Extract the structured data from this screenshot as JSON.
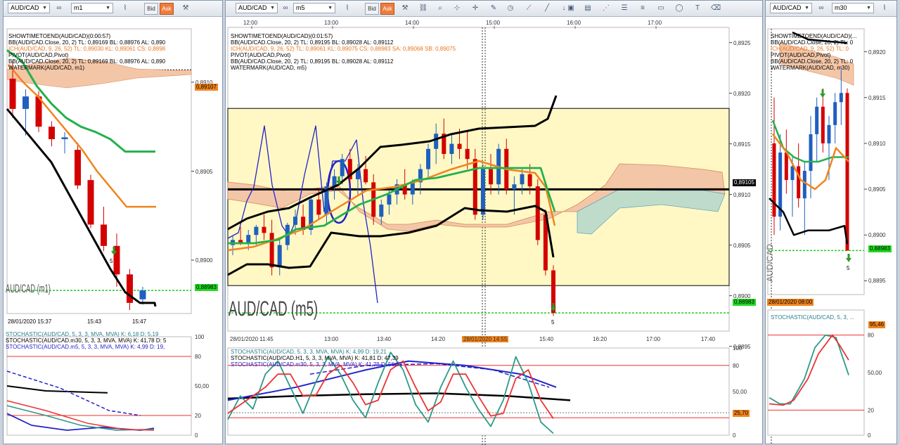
{
  "windows": [
    {
      "symbol": "AUD/CAD",
      "timeframe": "m1",
      "price_tick_labels": [
        "0,8910",
        "0,8905",
        "0,8900"
      ],
      "current_price": "0,88983",
      "pivot_price": "0,89107",
      "time_labels": [
        "28/01/2020 15:37",
        "15:43",
        "15:47"
      ],
      "watermark": "AUD/CAD (m1)",
      "indicator_lines": [
        {
          "text": "SHOWTIMETOEND(AUD/CAD)(0:00:57)",
          "color": "#000000"
        },
        {
          "text": "BB(AUD/CAD.Close, 20, 2)  TL: 0,89169  BL: 0,88976  AL: 0,890",
          "color": "#000000"
        },
        {
          "text": "ICH(AUD/CAD, 9, 26, 52)  TL: 0,89030  KL: 0,89061  CS: 0,8898",
          "color": "#e8761e"
        },
        {
          "text": "PIVOT(AUD/CAD,Pivot)",
          "color": "#000000"
        },
        {
          "text": "BB(AUD/CAD.Close, 20, 2)  TL: 0,89169  BL: 0,88976  AL: 0,890",
          "color": "#000000"
        },
        {
          "text": "WATERMARK(AUD/CAD, m1)",
          "color": "#000000"
        }
      ],
      "stoch_lines": [
        {
          "text": "STOCHASTIC(AUD/CAD, 5, 3, 3, MVA, MVA)  K: 6,18  D: 5,19",
          "color": "#2b7d8a"
        },
        {
          "text": "STOCHASTIC(AUD/CAD.m30, 5, 3, 3, MVA, MVA)  K: 41,78  D: 5",
          "color": "#000000"
        },
        {
          "text": "STOCHASTIC(AUD/CAD.m5, 5, 3, 3, MVA, MVA)  K: 4,99  D: 19,",
          "color": "#2222cc"
        }
      ],
      "stoch_ticks": [
        "100",
        "80",
        "50,00",
        "20",
        "0"
      ],
      "signal_label": "5"
    },
    {
      "symbol": "AUD/CAD",
      "timeframe": "m5",
      "price_tick_labels": [
        "0,8925",
        "0,8920",
        "0,8915",
        "0,8910",
        "0,8905",
        "0,8900",
        "0,8895"
      ],
      "current_price": "0,88983",
      "pivot_price": "0,89105",
      "top_time_labels": [
        "12:00",
        "13:00",
        "14:00",
        "15:00",
        "16:00",
        "17:00"
      ],
      "time_labels": [
        "28/01/2020 11:45",
        "13:00",
        "13:40",
        "14:20",
        "28/01/2020 14:55",
        "15:40",
        "16:20",
        "17:00",
        "17:40"
      ],
      "watermark": "AUD/CAD (m5)",
      "indicator_lines": [
        {
          "text": "SHOWTIMETOEND(AUD/CAD)(0:01:57)",
          "color": "#000000"
        },
        {
          "text": "BB(AUD/CAD.Close, 20, 2)  TL: 0,89195  BL: 0,89028  AL: 0,89112",
          "color": "#000000"
        },
        {
          "text": "ICH(AUD/CAD, 9, 26, 52)  TL: 0,89061  KL: 0,89075  CS: 0,88983  SA: 0,89068  SB: 0,89075",
          "color": "#e8761e"
        },
        {
          "text": "PIVOT(AUD/CAD,Pivot)",
          "color": "#000000"
        },
        {
          "text": "BB(AUD/CAD.Close, 20, 2)  TL: 0,89195  BL: 0,89028  AL: 0,89112",
          "color": "#000000"
        },
        {
          "text": "WATERMARK(AUD/CAD, m5)",
          "color": "#000000"
        }
      ],
      "stoch_lines": [
        {
          "text": "STOCHASTIC(AUD/CAD, 5, 3, 3, MVA, MVA)  K: 4,99  D: 19,21",
          "color": "#2b7d8a"
        },
        {
          "text": "STOCHASTIC(AUD/CAD.H1, 5, 3, 3, MVA, MVA)  K: 41,81  D: 47,39",
          "color": "#000000"
        },
        {
          "text": "STOCHASTIC(AUD/CAD.m30, 5, 3, 3, MVA, MVA)  K: 41,78  D: 56,81",
          "color": "#2222cc"
        }
      ],
      "stoch_ticks": [
        "100",
        "80",
        "50,00",
        "25,70",
        "0"
      ],
      "signal_label": "5"
    },
    {
      "symbol": "AUD/CAD",
      "timeframe": "m30",
      "price_tick_labels": [
        "0,8920",
        "0,8915",
        "0,8910",
        "0,8905",
        "0,8900",
        "0,8895"
      ],
      "current_price": "0,88983",
      "time_labels": [
        "28/01/2020 08:00"
      ],
      "watermark": "AUD/CAD",
      "indicator_lines": [
        {
          "text": "SHOWTIMETOEND(AUD/CAD)(...",
          "color": "#000000"
        },
        {
          "text": "BB(AUD/CAD.Close, 20, 2)  TL: 0",
          "color": "#000000"
        },
        {
          "text": "ICH(AUD/CAD, 9, 26, 52)  TL: 0",
          "color": "#e8761e"
        },
        {
          "text": "PIVOT(AUD/CAD,Pivot)",
          "color": "#000000"
        },
        {
          "text": "BB(AUD/CAD.Close, 20, 2)  TL: 0",
          "color": "#000000"
        },
        {
          "text": "WATERMARK(AUD/CAD, m30)",
          "color": "#000000"
        }
      ],
      "stoch_lines": [
        {
          "text": "STOCHASTIC(AUD/CAD, 5, 3, ...",
          "color": "#2b7d8a"
        }
      ],
      "stoch_ticks": [
        "95,46",
        "80",
        "50,00",
        "20",
        "0"
      ],
      "signal_label": "5"
    }
  ],
  "toolbar": {
    "bid_label": "Bid",
    "ask_label": "Ask"
  },
  "colors": {
    "bull": "#1f5fbf",
    "bear": "#d40000",
    "bb": "#000000",
    "tenkan": "#f0841e",
    "kijun": "#22b14c",
    "chikou": "#2222cc",
    "cloud_bear": "#f3c6a8",
    "cloud_bull": "#bfdccb",
    "price_line": "#22cc22",
    "highlight": "#fff8c4"
  },
  "chart_data": [
    {
      "type": "candlestick",
      "title": "AUD/CAD (m1)",
      "x": [
        "15:37",
        "15:38",
        "15:39",
        "15:40",
        "15:41",
        "15:42",
        "15:43",
        "15:44",
        "15:45",
        "15:46",
        "15:47"
      ],
      "ylim": [
        0.8897,
        0.8913
      ],
      "candles": [
        {
          "o": 0.89102,
          "h": 0.89112,
          "l": 0.8908,
          "c": 0.89085
        },
        {
          "o": 0.89085,
          "h": 0.89096,
          "l": 0.8907,
          "c": 0.89092
        },
        {
          "o": 0.89092,
          "h": 0.89095,
          "l": 0.89072,
          "c": 0.89075
        },
        {
          "o": 0.89075,
          "h": 0.89078,
          "l": 0.89064,
          "c": 0.89068
        },
        {
          "o": 0.89068,
          "h": 0.89072,
          "l": 0.8906,
          "c": 0.89069
        },
        {
          "o": 0.89062,
          "h": 0.89066,
          "l": 0.8904,
          "c": 0.89042
        },
        {
          "o": 0.89045,
          "h": 0.89048,
          "l": 0.89018,
          "c": 0.8902
        },
        {
          "o": 0.8902,
          "h": 0.8903,
          "l": 0.89005,
          "c": 0.89008
        },
        {
          "o": 0.89008,
          "h": 0.89015,
          "l": 0.88985,
          "c": 0.88992
        },
        {
          "o": 0.88992,
          "h": 0.88995,
          "l": 0.88972,
          "c": 0.88976
        },
        {
          "o": 0.88978,
          "h": 0.88985,
          "l": 0.88975,
          "c": 0.88983
        }
      ],
      "series": [
        {
          "name": "Kijun",
          "values": [
            0.89118,
            0.89112,
            0.89098,
            0.89088,
            0.8908,
            0.89075,
            0.89072,
            0.89068,
            0.89061,
            0.89061,
            0.89061
          ]
        },
        {
          "name": "Tenkan",
          "values": [
            0.8911,
            0.891,
            0.89092,
            0.89082,
            0.89072,
            0.89062,
            0.8905,
            0.8904,
            0.8903,
            0.8903,
            0.8903
          ]
        },
        {
          "name": "BB",
          "values": [
            0.89085,
            0.89075,
            0.89065,
            0.89055,
            0.8904,
            0.89025,
            0.8901,
            0.88995,
            0.88982,
            0.88976,
            0.88976
          ]
        }
      ]
    },
    {
      "type": "candlestick",
      "title": "AUD/CAD (m5)",
      "x_range": [
        "28/01/2020 11:45",
        "17:40"
      ],
      "ylim": [
        0.88965,
        0.89265
      ],
      "horizontal_levels": {
        "pivot": 0.89105,
        "current": 0.88983
      },
      "candles": [
        {
          "o": 0.8905,
          "h": 0.8906,
          "l": 0.8904,
          "c": 0.89055
        },
        {
          "o": 0.89055,
          "h": 0.89068,
          "l": 0.8905,
          "c": 0.89052
        },
        {
          "o": 0.89052,
          "h": 0.89065,
          "l": 0.89045,
          "c": 0.8906
        },
        {
          "o": 0.8906,
          "h": 0.8907,
          "l": 0.8905,
          "c": 0.89068
        },
        {
          "o": 0.89068,
          "h": 0.8908,
          "l": 0.89055,
          "c": 0.89062
        },
        {
          "o": 0.89062,
          "h": 0.89075,
          "l": 0.8902,
          "c": 0.89028
        },
        {
          "o": 0.89028,
          "h": 0.89055,
          "l": 0.8902,
          "c": 0.8905
        },
        {
          "o": 0.8905,
          "h": 0.89072,
          "l": 0.89045,
          "c": 0.8907
        },
        {
          "o": 0.8907,
          "h": 0.89085,
          "l": 0.8906,
          "c": 0.89078
        },
        {
          "o": 0.89078,
          "h": 0.8909,
          "l": 0.8906,
          "c": 0.89065
        },
        {
          "o": 0.89065,
          "h": 0.89098,
          "l": 0.8906,
          "c": 0.89095
        },
        {
          "o": 0.89095,
          "h": 0.89105,
          "l": 0.89075,
          "c": 0.8908
        },
        {
          "o": 0.8908,
          "h": 0.89112,
          "l": 0.8907,
          "c": 0.89108
        },
        {
          "o": 0.89108,
          "h": 0.89125,
          "l": 0.89095,
          "c": 0.89118
        },
        {
          "o": 0.89118,
          "h": 0.8914,
          "l": 0.8911,
          "c": 0.89135
        },
        {
          "o": 0.89135,
          "h": 0.89145,
          "l": 0.8911,
          "c": 0.89115
        },
        {
          "o": 0.89115,
          "h": 0.8913,
          "l": 0.891,
          "c": 0.89125
        },
        {
          "o": 0.89125,
          "h": 0.89138,
          "l": 0.8911,
          "c": 0.89112
        },
        {
          "o": 0.89112,
          "h": 0.8912,
          "l": 0.8907,
          "c": 0.89078
        },
        {
          "o": 0.89078,
          "h": 0.89095,
          "l": 0.8907,
          "c": 0.8909
        },
        {
          "o": 0.8909,
          "h": 0.89105,
          "l": 0.8908,
          "c": 0.891
        },
        {
          "o": 0.891,
          "h": 0.89115,
          "l": 0.8909,
          "c": 0.8911
        },
        {
          "o": 0.8911,
          "h": 0.89125,
          "l": 0.89095,
          "c": 0.891
        },
        {
          "o": 0.891,
          "h": 0.89115,
          "l": 0.8909,
          "c": 0.89112
        },
        {
          "o": 0.89112,
          "h": 0.8913,
          "l": 0.891,
          "c": 0.89125
        },
        {
          "o": 0.89125,
          "h": 0.8915,
          "l": 0.89115,
          "c": 0.89145
        },
        {
          "o": 0.89145,
          "h": 0.8917,
          "l": 0.8913,
          "c": 0.8916
        },
        {
          "o": 0.8916,
          "h": 0.89175,
          "l": 0.89135,
          "c": 0.8914
        },
        {
          "o": 0.8914,
          "h": 0.8916,
          "l": 0.8913,
          "c": 0.8915
        },
        {
          "o": 0.8915,
          "h": 0.89165,
          "l": 0.89135,
          "c": 0.89145
        },
        {
          "o": 0.89145,
          "h": 0.89162,
          "l": 0.89125,
          "c": 0.89135
        },
        {
          "o": 0.89135,
          "h": 0.89145,
          "l": 0.89075,
          "c": 0.8908
        },
        {
          "o": 0.8908,
          "h": 0.8913,
          "l": 0.89075,
          "c": 0.89125
        },
        {
          "o": 0.89125,
          "h": 0.8914,
          "l": 0.891,
          "c": 0.8911
        },
        {
          "o": 0.8911,
          "h": 0.8915,
          "l": 0.891,
          "c": 0.89145
        },
        {
          "o": 0.89145,
          "h": 0.89155,
          "l": 0.891,
          "c": 0.89105
        },
        {
          "o": 0.89105,
          "h": 0.89118,
          "l": 0.8908,
          "c": 0.8911
        },
        {
          "o": 0.8911,
          "h": 0.89125,
          "l": 0.891,
          "c": 0.8912
        },
        {
          "o": 0.8912,
          "h": 0.8913,
          "l": 0.891,
          "c": 0.89108
        },
        {
          "o": 0.89108,
          "h": 0.89115,
          "l": 0.8905,
          "c": 0.89055
        },
        {
          "o": 0.8908,
          "h": 0.89085,
          "l": 0.8902,
          "c": 0.89025
        },
        {
          "o": 0.89025,
          "h": 0.8903,
          "l": 0.8898,
          "c": 0.88983
        }
      ]
    },
    {
      "type": "candlestick",
      "title": "AUD/CAD (m30)",
      "x_range": [
        "28/01/2020 08:00"
      ],
      "ylim": [
        0.88935,
        0.89225
      ],
      "horizontal_levels": {
        "current": 0.88983
      }
    },
    {
      "type": "line",
      "title": "Stochastic (m5 panel)",
      "ylim": [
        0,
        100
      ],
      "series": [
        {
          "name": "STOCHASTIC(AUD/CAD) K",
          "values": [
            18,
            45,
            30,
            70,
            85,
            55,
            25,
            60,
            90,
            70,
            40,
            20,
            60,
            95,
            75,
            35,
            15,
            55,
            85,
            55,
            30,
            10,
            40,
            90,
            60,
            15,
            2
          ]
        },
        {
          "name": "STOCHASTIC(AUD/CAD) D",
          "values": [
            25,
            35,
            45,
            55,
            70,
            70,
            45,
            45,
            70,
            80,
            60,
            35,
            40,
            75,
            85,
            55,
            28,
            38,
            70,
            70,
            45,
            22,
            25,
            65,
            75,
            40,
            19
          ]
        }
      ]
    }
  ]
}
